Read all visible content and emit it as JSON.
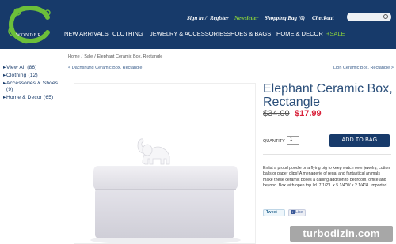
{
  "brand": {
    "name": "WONDER",
    "logo_icon": "green-c-swirl"
  },
  "header": {
    "utility_links": [
      {
        "label": "Sign in"
      },
      {
        "label": "/"
      },
      {
        "label": "Register"
      },
      {
        "label": "Newsletter"
      },
      {
        "label": "Shopping Bag (0)"
      },
      {
        "label": "Checkout"
      }
    ],
    "search": {
      "placeholder": "",
      "icon": "search-icon"
    }
  },
  "nav": {
    "items": [
      {
        "label": "NEW ARRIVALS"
      },
      {
        "label": "CLOTHING"
      },
      {
        "label": "JEWELRY & ACCESSORIES"
      },
      {
        "label": "SHOES & BAGS"
      },
      {
        "label": "HOME & DECOR"
      },
      {
        "label": "+SALE"
      }
    ]
  },
  "sidebar": {
    "items": [
      {
        "label": "View All (86)"
      },
      {
        "label": "Clothing (12)"
      },
      {
        "label": "Accessories & Shoes (9)"
      },
      {
        "label": "Home & Decor (65)"
      }
    ]
  },
  "breadcrumb": {
    "home": "Home",
    "sale": "Sale",
    "current": "Elephant Ceramic Box, Rectangle"
  },
  "pager": {
    "prev": "< Dachshund Ceramic Box, Rectangle",
    "next": "Lion Ceramic Box, Rectangle >"
  },
  "product": {
    "title": "Elephant Ceramic Box, Rectangle",
    "price_old": "$34.00",
    "price_new": "$17.99",
    "quantity_label": "QUANTITY",
    "quantity_value": "1",
    "add_button": "ADD TO BAG",
    "description": "Enlist a proud poodle or a flying pig to keep watch over jewelry, cotton balls or paper clips! A menagerie of regal and fantastical animals make these ceramic boxes a darling addition to bedroom, office and beyond. Box with open top lid. 7 1/2\"L x 5 1/4\"W x 2 1/4\"H. Imported.",
    "tweet_label": "Tweet",
    "like_label": "Like"
  },
  "watermark": "turbodizin.com",
  "colors": {
    "header_bg": "#173a6a",
    "accent_green": "#8ad13c",
    "sale_price": "#d9223b",
    "title_blue": "#2b4f7a"
  }
}
